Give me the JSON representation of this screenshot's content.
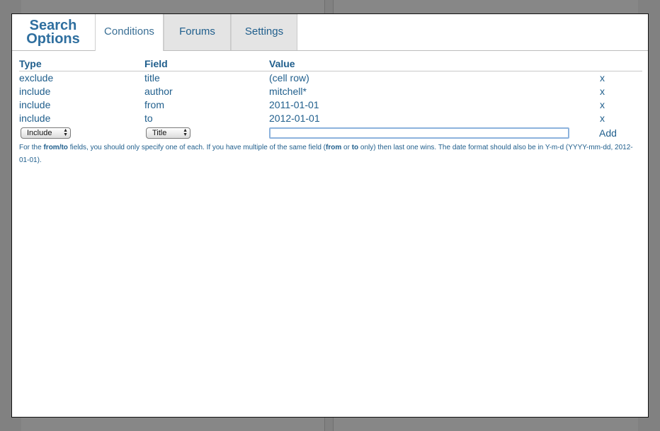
{
  "modal": {
    "title_line1": "Search",
    "title_line2": "Options"
  },
  "tabs": [
    {
      "label": "Conditions",
      "active": true
    },
    {
      "label": "Forums",
      "active": false
    },
    {
      "label": "Settings",
      "active": false
    }
  ],
  "table": {
    "headers": {
      "type": "Type",
      "field": "Field",
      "value": "Value"
    },
    "rows": [
      {
        "type": "exclude",
        "field": "title",
        "value": "(cell row)",
        "remove": "x"
      },
      {
        "type": "include",
        "field": "author",
        "value": "mitchell*",
        "remove": "x"
      },
      {
        "type": "include",
        "field": "from",
        "value": "2011-01-01",
        "remove": "x"
      },
      {
        "type": "include",
        "field": "to",
        "value": "2012-01-01",
        "remove": "x"
      }
    ]
  },
  "new_condition": {
    "type_select": "Include",
    "field_select": "Title",
    "value_input": "",
    "add_label": "Add"
  },
  "help": {
    "p1": "For the ",
    "b1": "from/to",
    "p2": " fields, you should only specify one of each. If you have multiple of the same field (",
    "b2": "from",
    "p3": " or ",
    "b3": "to",
    "p4": " only) then last one wins. The date format should also be in Y-m-d (YYYY-mm-dd, 2012-01-01)."
  },
  "colors": {
    "accent": "#1f5e8c",
    "title": "#2f6f9f",
    "overlay": "#7d7d7d",
    "focus_ring": "#8db3dd"
  },
  "icons": {
    "select_arrows": "updown-arrows-icon"
  }
}
